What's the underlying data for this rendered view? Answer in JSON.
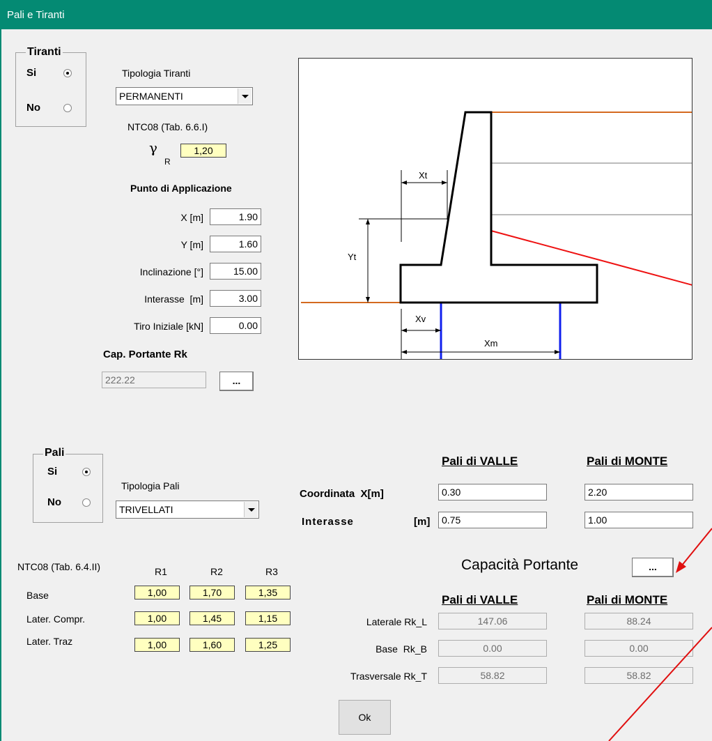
{
  "window": {
    "title": "Pali e Tiranti"
  },
  "tiranti": {
    "legend": "Tiranti",
    "si_label": "Si",
    "no_label": "No",
    "selected": "Si",
    "tipologia_label": "Tipologia Tiranti",
    "tipologia_value": "PERMANENTI",
    "ntc_label": "NTC08 (Tab. 6.6.I)",
    "gamma_symbol": "γ",
    "gamma_sub": "R",
    "gamma_value": "1,20",
    "punto_title": "Punto di Applicazione",
    "fields": [
      {
        "label": "X [m]",
        "value": "1.90"
      },
      {
        "label": "Y [m]",
        "value": "1.60"
      },
      {
        "label": "Inclinazione [°]",
        "value": "15.00"
      },
      {
        "label": "Interasse  [m]",
        "value": "3.00"
      },
      {
        "label": "Tiro Iniziale [kN]",
        "value": "0.00"
      }
    ],
    "cap_title": "Cap. Portante Rk",
    "cap_value": "222.22",
    "cap_button": "..."
  },
  "diagram": {
    "labels": {
      "xt": "Xt",
      "yt": "Yt",
      "xv": "Xv",
      "xm": "Xm"
    },
    "colors": {
      "ground": "#d4691f",
      "anchor": "#ee1111",
      "piles": "#1020ee",
      "structure": "#000000"
    }
  },
  "pali": {
    "legend": "Pali",
    "si_label": "Si",
    "no_label": "No",
    "selected": "Si",
    "tipologia_label": "Tipologia Pali",
    "tipologia_value": "TRIVELLATI",
    "valle_header": "Pali di VALLE",
    "monte_header": "Pali di MONTE",
    "coord_label": "Coordinata  X[m]",
    "interasse_label": "Interasse",
    "interasse_unit": "[m]",
    "coord_valle": "0.30",
    "coord_monte": "2.20",
    "interasse_valle": "0.75",
    "interasse_monte": "1.00"
  },
  "ntc_table": {
    "title": "NTC08 (Tab. 6.4.II)",
    "columns": [
      "R1",
      "R2",
      "R3"
    ],
    "rows": [
      {
        "label": "Base",
        "values": [
          "1,00",
          "1,70",
          "1,35"
        ]
      },
      {
        "label": "Later. Compr.",
        "values": [
          "1,00",
          "1,45",
          "1,15"
        ]
      },
      {
        "label": "Later. Traz",
        "values": [
          "1,00",
          "1,60",
          "1,25"
        ]
      }
    ]
  },
  "capacita": {
    "title": "Capacità Portante",
    "button": "...",
    "valle_header": "Pali di VALLE",
    "monte_header": "Pali di MONTE",
    "rows": [
      {
        "label": "Laterale Rk_L",
        "valle": "147.06",
        "monte": "88.24"
      },
      {
        "label": "Base  Rk_B",
        "valle": "0.00",
        "monte": "0.00"
      },
      {
        "label": "Trasversale Rk_T",
        "valle": "58.82",
        "monte": "58.82"
      }
    ]
  },
  "ok_button": "Ok",
  "annotation_color": "#e01010"
}
